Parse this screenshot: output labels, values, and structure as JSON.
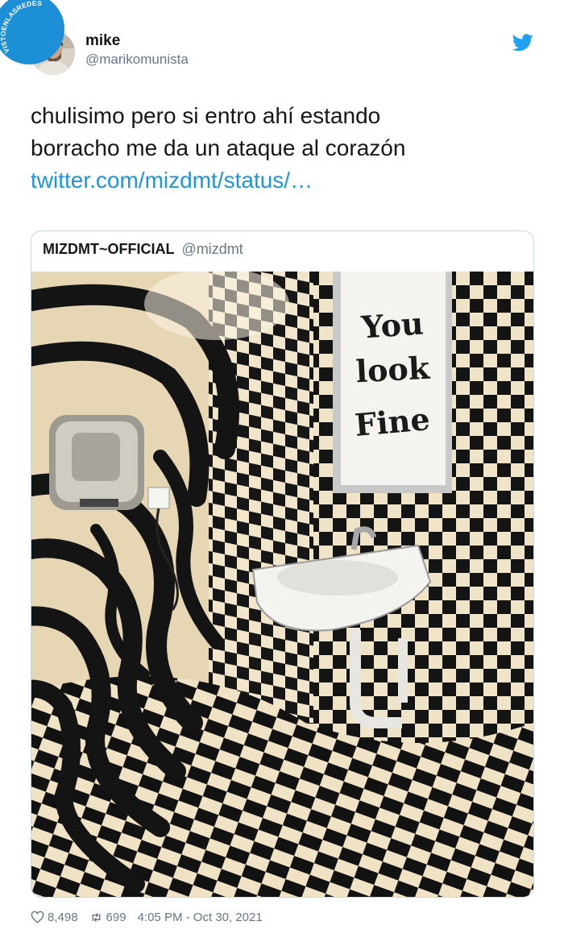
{
  "watermark": {
    "text": "VISTOENLASREDES",
    "icon": "watermark-badge-icon"
  },
  "author": {
    "name": "mike",
    "handle": "@marikomunista",
    "avatar_icon": "avatar-photo",
    "platform_icon": "twitter-bird-icon",
    "brand_color": "#1da1f2"
  },
  "tweet": {
    "line1": "chulisimo pero si entro ahí estando",
    "line2": "borracho me da un ataque al corazón",
    "link": "twitter.com/mizdmt/status/…",
    "link_color": "#1b95e0"
  },
  "quoted": {
    "name": "MIZDMT~OFFICIAL",
    "handle": "@mizdmt",
    "image": {
      "subject": "checkered optical-illusion bathroom with sink and hand dryer",
      "mirror_text": "You look Fine"
    }
  },
  "footer": {
    "likes": "8,498",
    "retweets": "699",
    "timestamp": "4:05 PM - Oct 30, 2021",
    "like_icon": "heart-icon",
    "retweet_icon": "retweet-icon"
  }
}
